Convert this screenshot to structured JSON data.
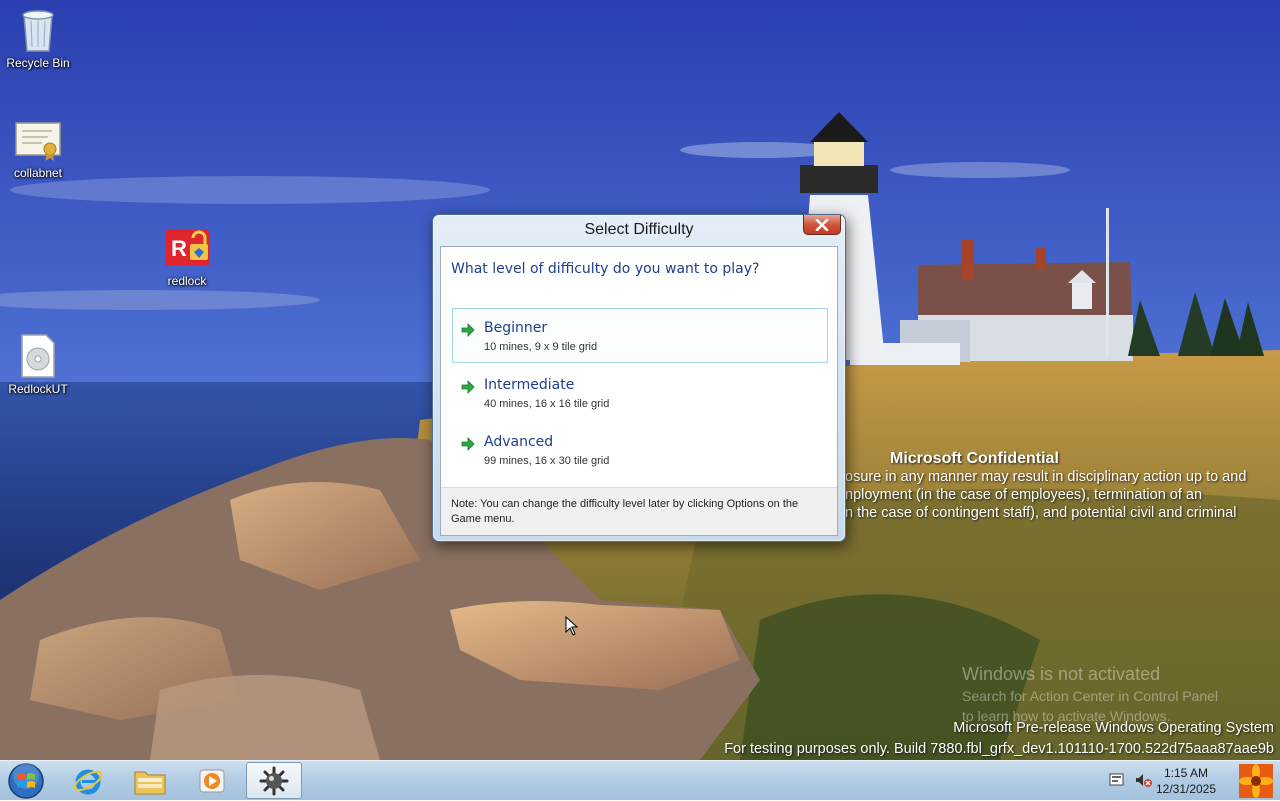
{
  "desktop": {
    "icons": [
      {
        "label": "Recycle Bin",
        "icon": "recycle-bin-icon"
      },
      {
        "label": "collabnet",
        "icon": "certificate-icon"
      },
      {
        "label": "redlock",
        "icon": "redlock-app-icon"
      },
      {
        "label": "RedlockUT",
        "icon": "disc-file-icon"
      }
    ]
  },
  "watermark": {
    "confidential_title": "Microsoft Confidential",
    "confidential_lines": [
      "osure in any manner may result in disciplinary action up to and",
      "nployment (in the case of employees), termination of an",
      "n the case of contingent staff), and potential civil and criminal"
    ],
    "activation_title": "Windows is not activated",
    "activation_lines": [
      "Search for Action Center in Control Panel",
      "to learn how to activate Windows."
    ],
    "build_lines": [
      "Microsoft Pre-release Windows Operating System",
      "For testing purposes only. Build 7880.fbl_grfx_dev1.101110-1700.522d75aaa87aae9b"
    ]
  },
  "dialog": {
    "title": "Select Difficulty",
    "question": "What level of difficulty do you want to play?",
    "options": [
      {
        "title": "Beginner",
        "desc": "10 mines, 9 x 9 tile grid"
      },
      {
        "title": "Intermediate",
        "desc": "40 mines, 16 x 16 tile grid"
      },
      {
        "title": "Advanced",
        "desc": "99 mines, 16 x 30 tile grid"
      }
    ],
    "note": "Note: You can change the difficulty level later by clicking Options on the Game menu."
  },
  "taskbar": {
    "pinned": [
      "internet-explorer-icon",
      "file-explorer-icon",
      "media-player-icon",
      "minesweeper-icon"
    ],
    "clock_time": "1:15 AM",
    "clock_date": "12/31/2025"
  },
  "colors": {
    "link_blue": "#1e3f8a",
    "arrow_green": "#2aa844",
    "hover_border": "#9fd3ee",
    "close_red": "#c33a22"
  }
}
